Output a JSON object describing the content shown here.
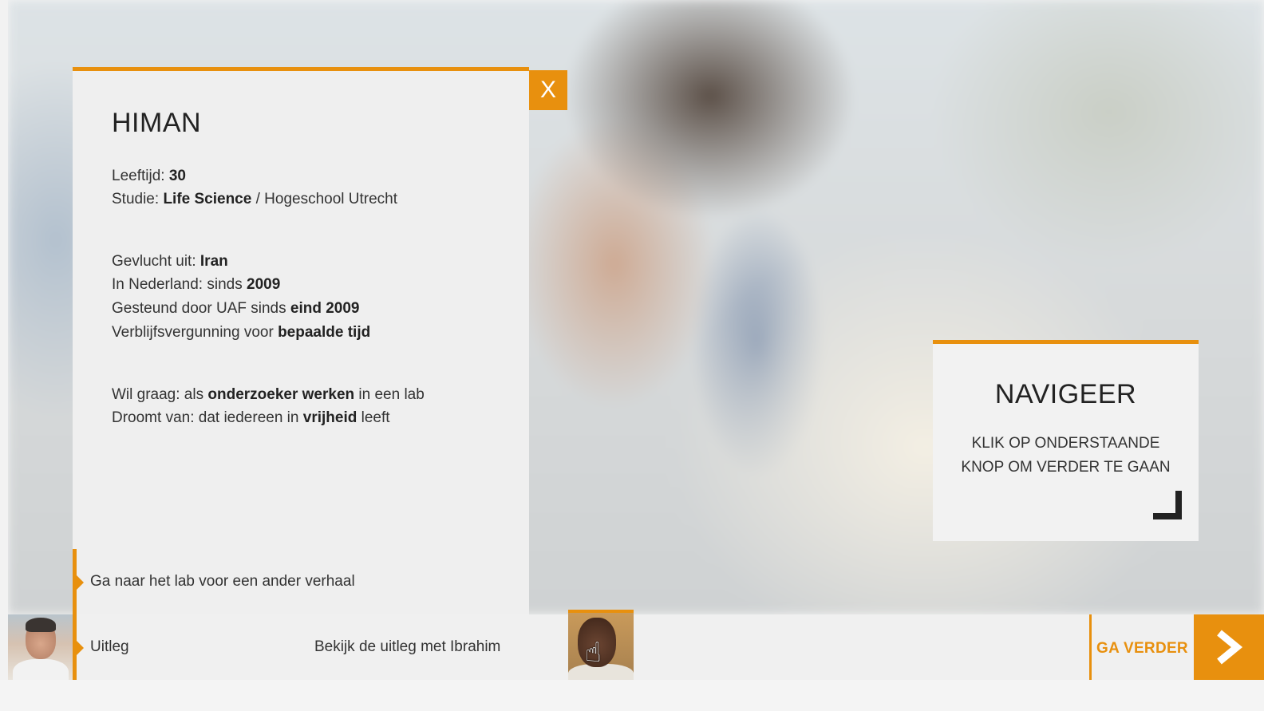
{
  "profile": {
    "name": "HIMAN",
    "close_label": "X",
    "leeftijd": {
      "label": "Leeftijd: ",
      "value": "30"
    },
    "studie": {
      "label": "Studie: ",
      "value": "Life Science",
      "rest": " / Hogeschool Utrecht"
    },
    "gevlucht": {
      "label": "Gevlucht uit: ",
      "value": "Iran"
    },
    "nederland": {
      "label": "In Nederland: sinds ",
      "value": "2009"
    },
    "gesteund": {
      "label": "Gesteund door UAF sinds ",
      "value": "eind 2009"
    },
    "verblijf": {
      "label": "Verblijfsvergunning voor ",
      "value": "bepaalde tijd"
    },
    "wil": {
      "label": "Wil graag: als ",
      "value": "onderzoeker werken",
      "rest": " in een lab"
    },
    "droomt": {
      "label": "Droomt van: dat iedereen in ",
      "value": "vrijheid",
      "rest": " leeft"
    }
  },
  "navigation": {
    "lab_link": "Ga naar het lab voor een ander verhaal",
    "uitleg_label": "Uitleg",
    "ibrahim_text": "Bekijk de uitleg met Ibrahim",
    "verder_label": "GA VERDER"
  },
  "nav_panel": {
    "title": "NAVIGEER",
    "line1": "KLIK OP ONDERSTAANDE",
    "line2": "KNOP OM VERDER TE GAAN"
  },
  "icons": {
    "close": "close-icon",
    "next": "chevron-right-icon",
    "corner": "corner-arrow-icon",
    "cursor": "hand-pointer-icon"
  },
  "colors": {
    "accent": "#e8900e",
    "panel": "#efefef"
  }
}
